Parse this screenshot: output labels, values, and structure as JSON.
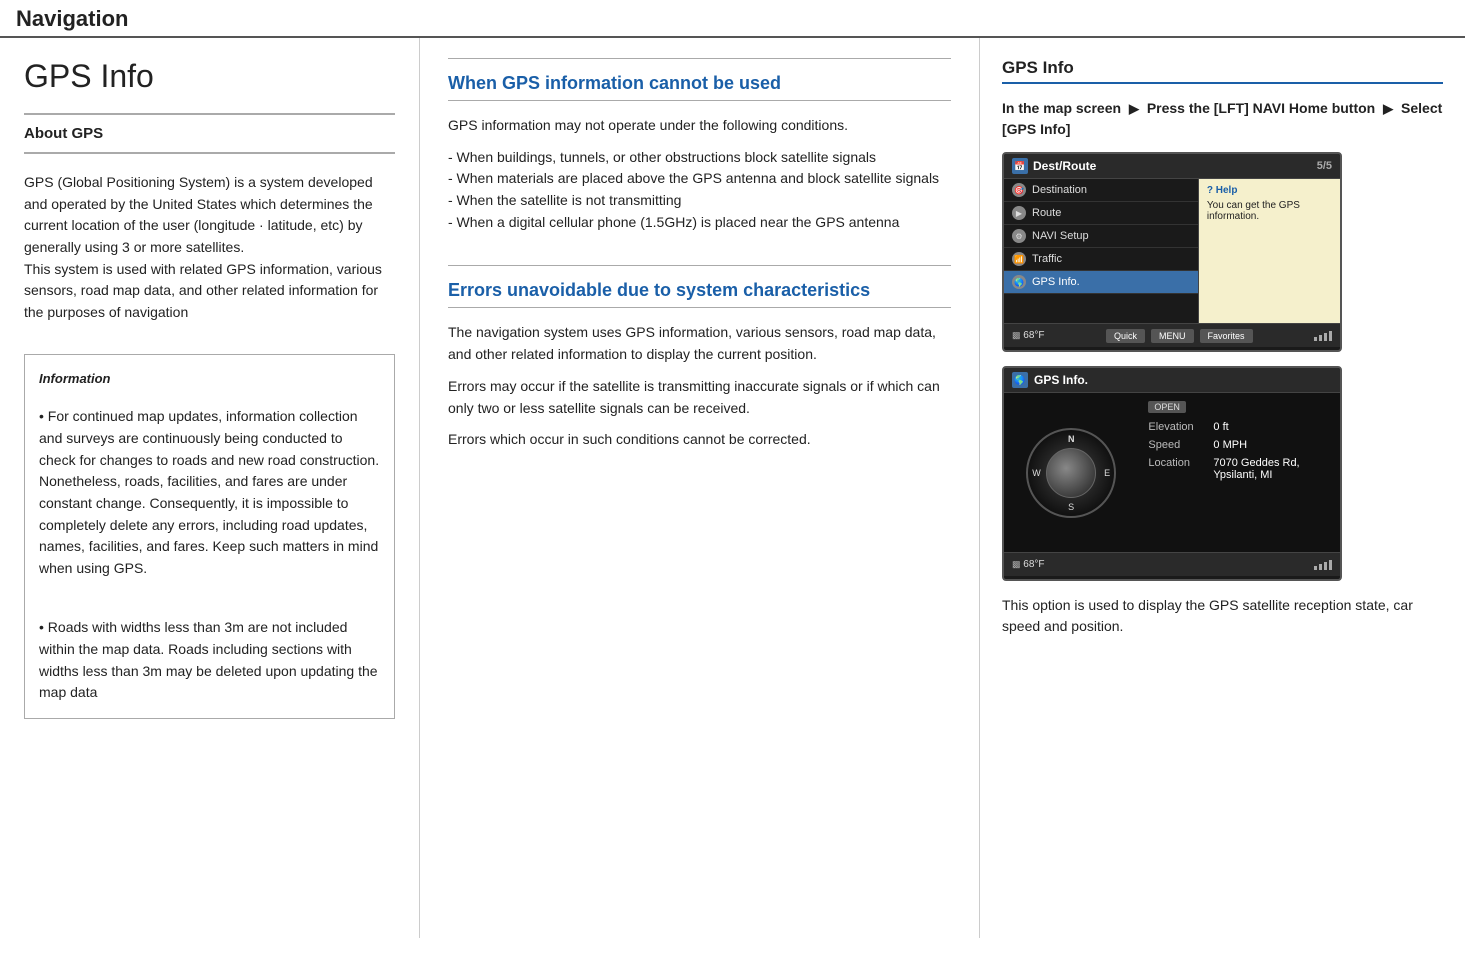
{
  "header": {
    "title": "Navigation"
  },
  "left": {
    "section_title": "GPS Info",
    "about_title": "About GPS",
    "body_text": "GPS (Global Positioning System) is a system developed and operated by the United States which determines the current location of the user (longitude · latitude, etc) by generally using 3 or more satellites.\nThis system is used with related GPS information, various sensors, road map data, and other related information for the purposes of navigation",
    "info_box": {
      "title": "Information",
      "bullet1": "• For continued map updates, information collection and surveys are continuously being conducted to check for changes to roads and new road construction. Nonetheless, roads, facilities, and fares are under constant change. Consequently, it is impossible to completely delete any errors, including road updates, names, facilities, and fares. Keep such matters in mind when using GPS.",
      "bullet2": "• Roads with widths less than 3m are not included within the map data. Roads including sections with widths less than 3m may be deleted upon updating the map data"
    }
  },
  "middle": {
    "section1": {
      "title": "When GPS information cannot be used",
      "intro": "GPS information may not operate under the following conditions.",
      "bullets": "- When buildings, tunnels, or other obstructions block satellite signals\n- When materials are placed above the GPS antenna and block satellite signals\n- When the satellite is not transmitting\n- When a digital cellular phone (1.5GHz) is placed near the GPS antenna"
    },
    "section2": {
      "title": "Errors unavoidable due to system characteristics",
      "para1": "The navigation system uses GPS information, various sensors, road map data, and other related information to display the current position.",
      "para2": "Errors may occur if the satellite is transmitting inaccurate signals or if which can only two or less satellite signals can be received.",
      "para3": "Errors which occur in such conditions cannot be corrected."
    }
  },
  "right": {
    "section_title": "GPS Info",
    "instruction": "In the map screen ▶ Press the [LFT] NAVI Home button ▶ Select [GPS Info]",
    "screen1": {
      "header": "Dest/Route",
      "page": "5/5",
      "menu_items": [
        {
          "label": "Destination",
          "active": false
        },
        {
          "label": "Route",
          "active": false
        },
        {
          "label": "NAVI Setup",
          "active": false
        },
        {
          "label": "Traffic",
          "active": false
        },
        {
          "label": "GPS Info.",
          "active": true
        }
      ],
      "help_title": "? Help",
      "help_text": "You can get the GPS information.",
      "footer_btns": [
        "Quick",
        "MENU",
        "Favorites"
      ],
      "temp": "68°F"
    },
    "screen2": {
      "header": "GPS Info.",
      "open_label": "OPEN",
      "compass_labels": {
        "n": "N",
        "s": "S",
        "e": "E",
        "w": "W"
      },
      "info_rows": [
        {
          "label": "Elevation",
          "value": "0 ft"
        },
        {
          "label": "Speed",
          "value": "0 MPH"
        },
        {
          "label": "Location",
          "value": "7070 Geddes Rd, Ypsilanti, MI"
        }
      ],
      "temp": "68°F"
    },
    "description": "This option is used to display the GPS satellite reception state, car speed and position."
  }
}
